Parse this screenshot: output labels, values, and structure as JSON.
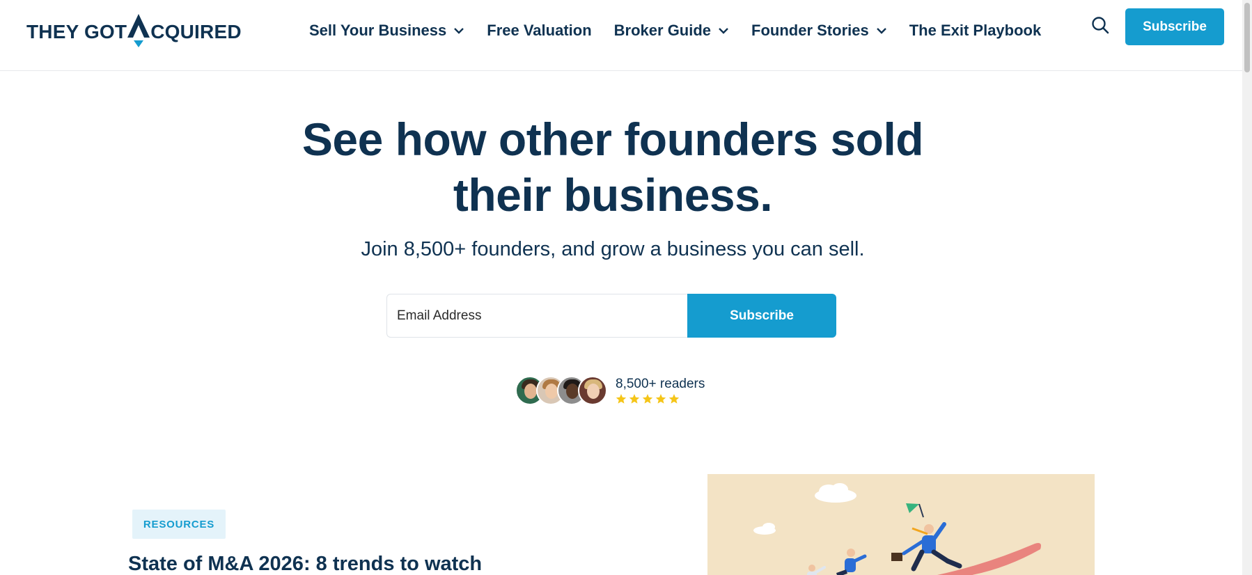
{
  "header": {
    "logo_text_left": "THEY GOT ",
    "logo_text_right": "CQUIRED",
    "nav": [
      {
        "label": "Sell Your Business",
        "has_dropdown": true
      },
      {
        "label": "Free Valuation",
        "has_dropdown": false
      },
      {
        "label": "Broker Guide",
        "has_dropdown": true
      },
      {
        "label": "Founder Stories",
        "has_dropdown": true
      },
      {
        "label": "The Exit Playbook",
        "has_dropdown": false
      }
    ],
    "search_icon": "search-icon",
    "subscribe_label": "Subscribe"
  },
  "hero": {
    "title_line1": "See how other founders sold",
    "title_line2": "their business.",
    "subtitle": "Join 8,500+ founders, and grow a business you can sell.",
    "email_placeholder": "Email Address",
    "submit_label": "Subscribe",
    "readers_label": "8,500+ readers",
    "rating_stars": 5
  },
  "article": {
    "tag": "RESOURCES",
    "title": "State of M&A 2026: 8 trends to watch"
  },
  "colors": {
    "navy": "#0f3251",
    "accent": "#159ccf",
    "tag_bg": "#e4f3fa",
    "star": "#f5c518",
    "illustration_bg": "#f3e3c5"
  }
}
